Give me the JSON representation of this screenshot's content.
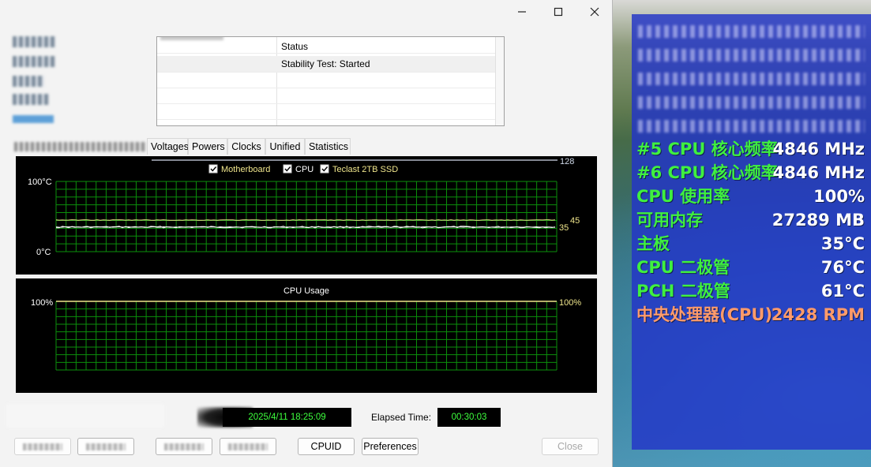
{
  "colors": {
    "osd_green": "#3ff03f",
    "osd_white": "#ffffff",
    "osd_orange": "#ff9b6a",
    "chart_grid": "#0b8f0b",
    "chart_border": "#10b010",
    "series_motherboard": "#f5f5f5",
    "series_cpu": "#ffffff",
    "series_ssd": "#f0e68c",
    "timestamp_green": "#3dff3d"
  },
  "titlebar": {
    "minimize_icon": "minimize-icon",
    "maximize_icon": "maximize-icon",
    "close_icon": "close-icon"
  },
  "status_table": {
    "header": "Status",
    "rows": [
      "Stability Test: Started",
      "",
      "",
      ""
    ]
  },
  "tabs": [
    "Voltages",
    "Powers",
    "Clocks",
    "Unified",
    "Statistics"
  ],
  "chart_data": [
    {
      "type": "line",
      "legend": [
        {
          "name": "Motherboard",
          "checked": true
        },
        {
          "name": "CPU",
          "checked": true
        },
        {
          "name": "Teclast 2TB SSD",
          "checked": true
        }
      ],
      "ylim": [
        0,
        100
      ],
      "y_tick_labels": [
        "100°C",
        "0°C"
      ],
      "scale_label": "128",
      "right_value_labels": [
        "45",
        "35"
      ],
      "series": [
        {
          "name": "Motherboard",
          "value": 35
        },
        {
          "name": "CPU",
          "value": 35
        },
        {
          "name": "Teclast 2TB SSD",
          "value": 45
        }
      ]
    },
    {
      "type": "line",
      "title": "CPU Usage",
      "ylim": [
        0,
        100
      ],
      "y_tick_labels": [
        "100%"
      ],
      "right_value_labels": [
        "100%"
      ],
      "series": [
        {
          "name": "CPU Usage",
          "value": 100
        }
      ]
    }
  ],
  "bottom": {
    "start_time": "2025/4/11 18:25:09",
    "elapsed_label": "Elapsed Time:",
    "elapsed_value": "00:30:03",
    "buttons": {
      "cpuid": "CPUID",
      "preferences": "Preferences",
      "close": "Close"
    }
  },
  "osd": {
    "rows": [
      {
        "label": "#5 CPU 核心频率",
        "value": "4846 MHz",
        "color": "green"
      },
      {
        "label": "#6 CPU 核心频率",
        "value": "4846 MHz",
        "color": "green"
      },
      {
        "label": "CPU 使用率",
        "value": "100%",
        "color": "green"
      },
      {
        "label": "可用内存",
        "value": "27289 MB",
        "color": "green"
      },
      {
        "label": "主板",
        "value": "35°C",
        "color": "green"
      },
      {
        "label": "CPU 二极管",
        "value": "76°C",
        "color": "green"
      },
      {
        "label": "PCH 二极管",
        "value": "61°C",
        "color": "green"
      },
      {
        "label": "中央处理器(CPU)",
        "value": "2428 RPM",
        "color": "orange"
      }
    ]
  }
}
